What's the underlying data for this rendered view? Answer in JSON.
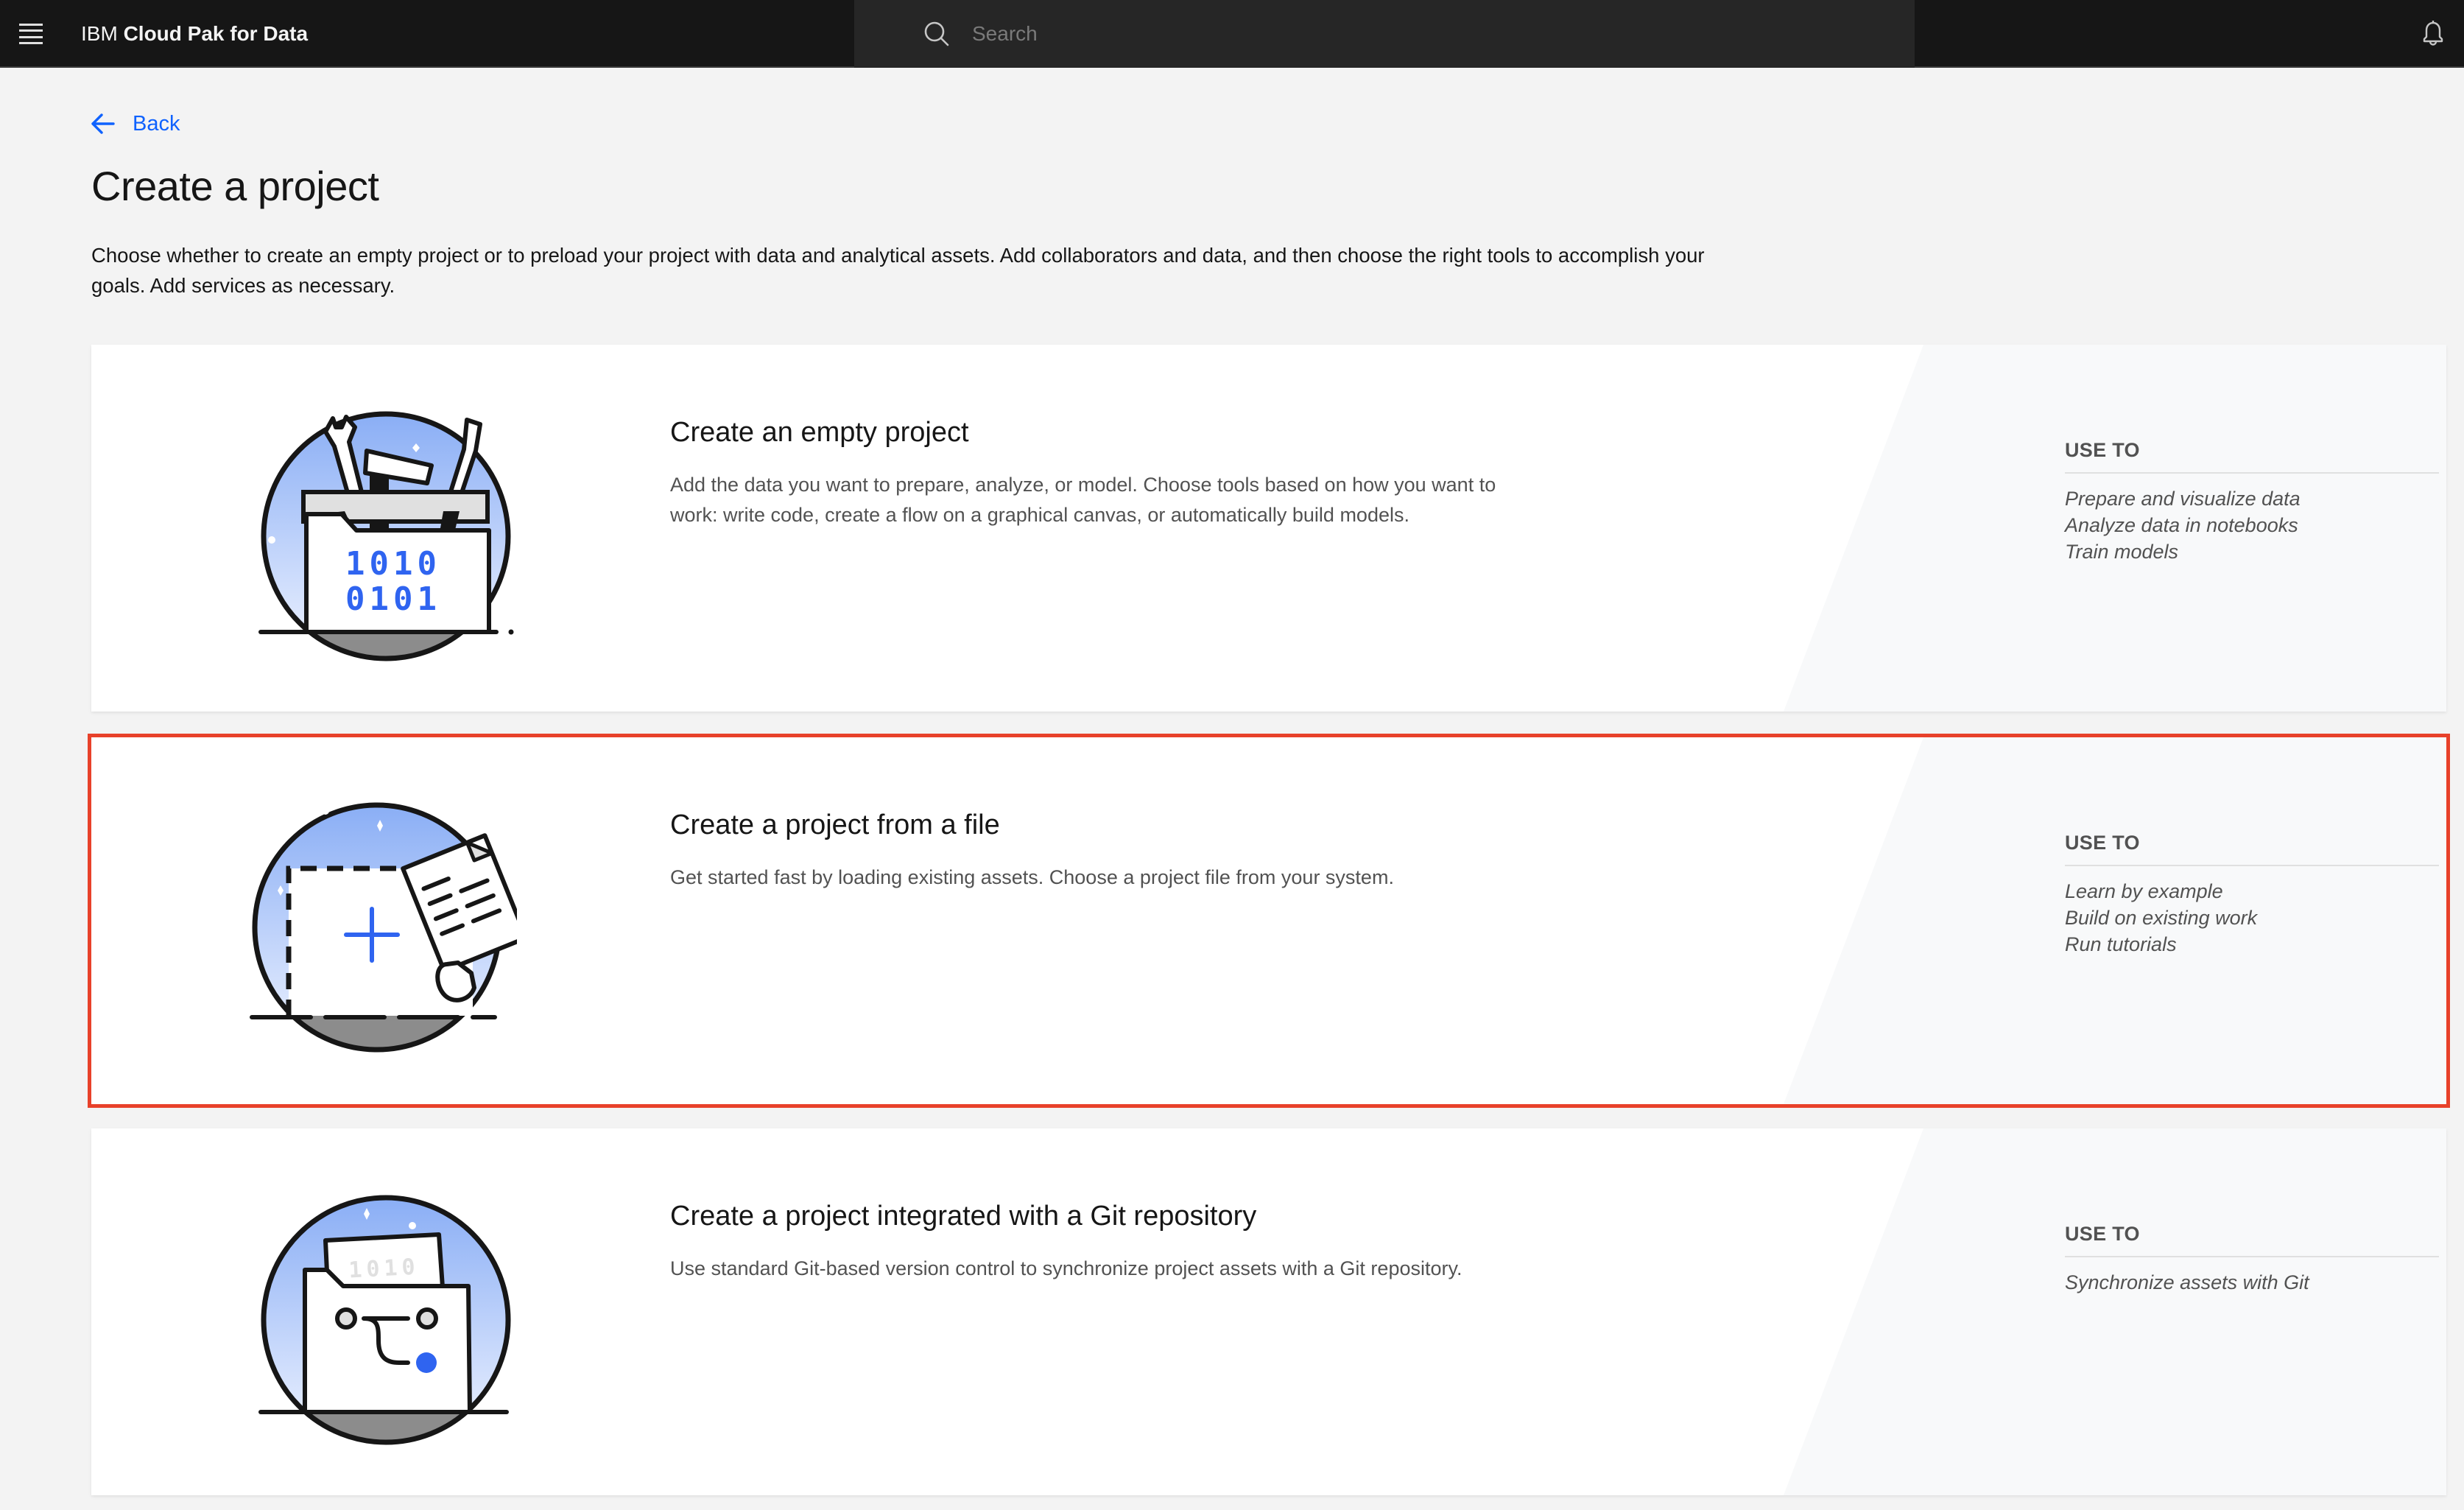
{
  "header": {
    "brand_prefix": "IBM",
    "brand_name": "Cloud Pak for Data",
    "search_placeholder": "Search",
    "search_value": ""
  },
  "nav": {
    "back_label": "Back"
  },
  "page": {
    "title": "Create a project",
    "description": "Choose whether to create an empty project or to preload your project with data and analytical assets. Add collaborators and data, and then choose the right tools to accomplish your goals. Add services as necessary."
  },
  "cards": [
    {
      "id": "empty",
      "title": "Create an empty project",
      "description": "Add the data you want to prepare, analyze, or model. Choose tools based on how you want to work: write code, create a flow on a graphical canvas, or automatically build models.",
      "use_to_label": "USE TO",
      "use_to": [
        "Prepare and visualize data",
        "Analyze data in notebooks",
        "Train models"
      ],
      "illustration": "toolbox-folder-icon",
      "illustration_text": [
        "1010",
        "0101"
      ],
      "selected": false
    },
    {
      "id": "from-file",
      "title": "Create a project from a file",
      "description": "Get started fast by loading existing assets. Choose a project file from your system.",
      "use_to_label": "USE TO",
      "use_to": [
        "Learn by example",
        "Build on existing work",
        "Run tutorials"
      ],
      "illustration": "file-upload-icon",
      "selected": true
    },
    {
      "id": "git",
      "title": "Create a project integrated with a Git repository",
      "description": "Use standard Git-based version control to synchronize project assets with a Git repository.",
      "use_to_label": "USE TO",
      "use_to": [
        "Synchronize assets with Git"
      ],
      "illustration": "git-folder-icon",
      "illustration_text": [
        "1010"
      ],
      "selected": false
    }
  ],
  "colors": {
    "header_bg": "#161616",
    "search_bg": "#262626",
    "link": "#0f62fe",
    "selection_outline": "#e8412a",
    "illustration_blue": "#2f64f0",
    "page_bg": "#f3f3f3"
  }
}
